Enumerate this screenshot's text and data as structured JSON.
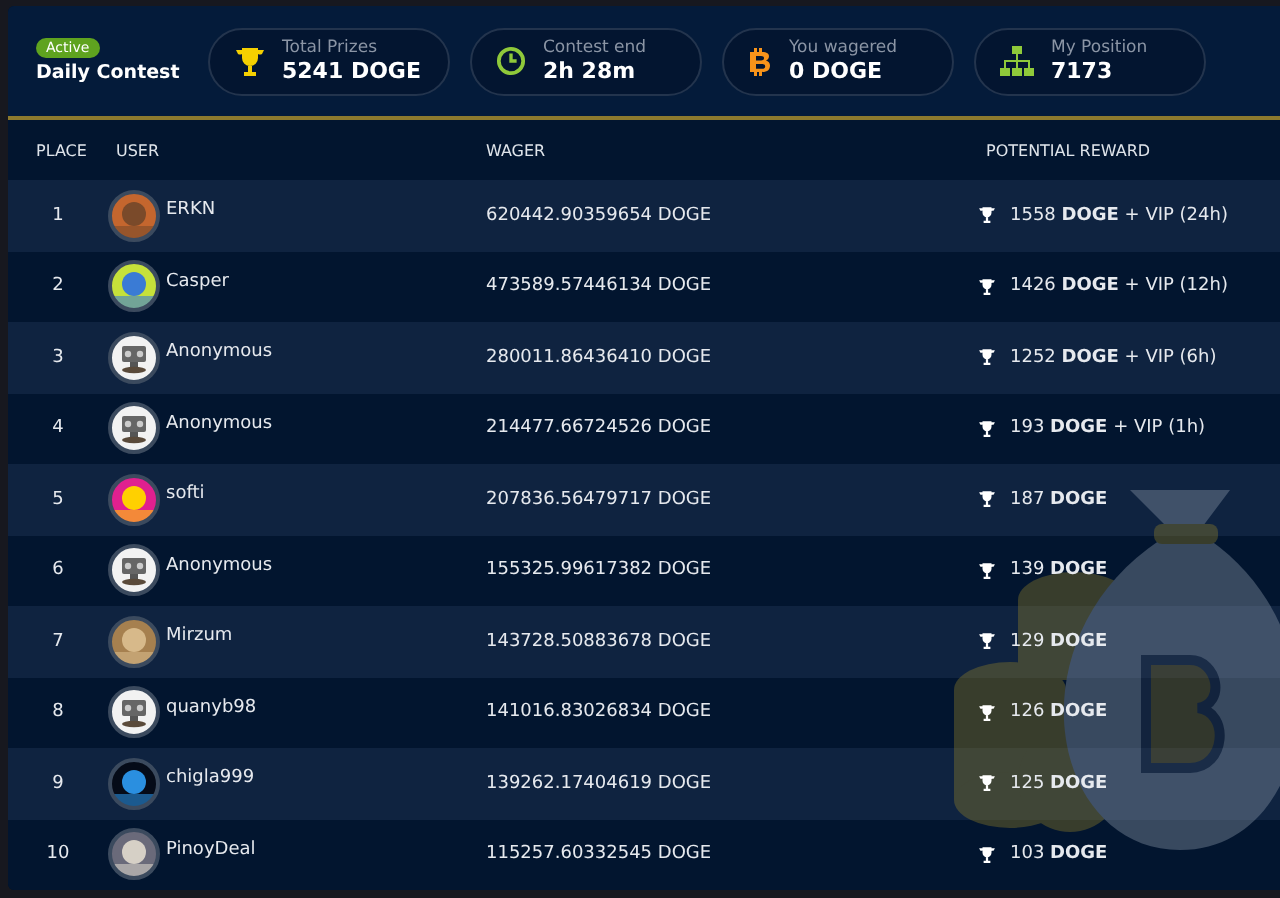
{
  "contest": {
    "status": "Active",
    "title": "Daily Contest"
  },
  "stats": [
    {
      "kind": "trophy",
      "label": "Total Prizes",
      "value": "5241 DOGE"
    },
    {
      "kind": "clock",
      "label": "Contest end",
      "value": "2h 28m"
    },
    {
      "kind": "bitcoin",
      "label": "You wagered",
      "value": "0 DOGE"
    },
    {
      "kind": "hierarchy",
      "label": "My Position",
      "value": "7173"
    }
  ],
  "table": {
    "columns": [
      "PLACE",
      "USER",
      "WAGER",
      "POTENTIAL REWARD"
    ],
    "rows": [
      {
        "place": "1",
        "user": "ERKN",
        "kind": "picture",
        "wager": "620442.90359654 DOGE",
        "reward": "1558 **DOGE** + VIP (24h)"
      },
      {
        "place": "2",
        "user": "Casper",
        "kind": "picture",
        "wager": "473589.57446134 DOGE",
        "reward": "1426 **DOGE** + VIP (12h)"
      },
      {
        "place": "3",
        "user": "Anonymous",
        "kind": "robot",
        "wager": "280011.86436410 DOGE",
        "reward": "1252 **DOGE** + VIP (6h)"
      },
      {
        "place": "4",
        "user": "Anonymous",
        "kind": "robot",
        "wager": "214477.66724526 DOGE",
        "reward": "193 **DOGE** + VIP (1h)"
      },
      {
        "place": "5",
        "user": "softi",
        "kind": "picture",
        "wager": "207836.56479717 DOGE",
        "reward": "187 **DOGE**"
      },
      {
        "place": "6",
        "user": "Anonymous",
        "kind": "robot",
        "wager": "155325.99617382 DOGE",
        "reward": "139 **DOGE**"
      },
      {
        "place": "7",
        "user": "Mirzum",
        "kind": "picture",
        "wager": "143728.50883678 DOGE",
        "reward": "129 **DOGE**"
      },
      {
        "place": "8",
        "user": "quanyb98",
        "kind": "robot",
        "wager": "141016.83026834 DOGE",
        "reward": "126 **DOGE**"
      },
      {
        "place": "9",
        "user": "chigla999",
        "kind": "picture",
        "wager": "139262.17404619 DOGE",
        "reward": "125 **DOGE**"
      },
      {
        "place": "10",
        "user": "PinoyDeal",
        "kind": "picture",
        "wager": "115257.60332545 DOGE",
        "reward": "103 **DOGE**"
      }
    ]
  }
}
